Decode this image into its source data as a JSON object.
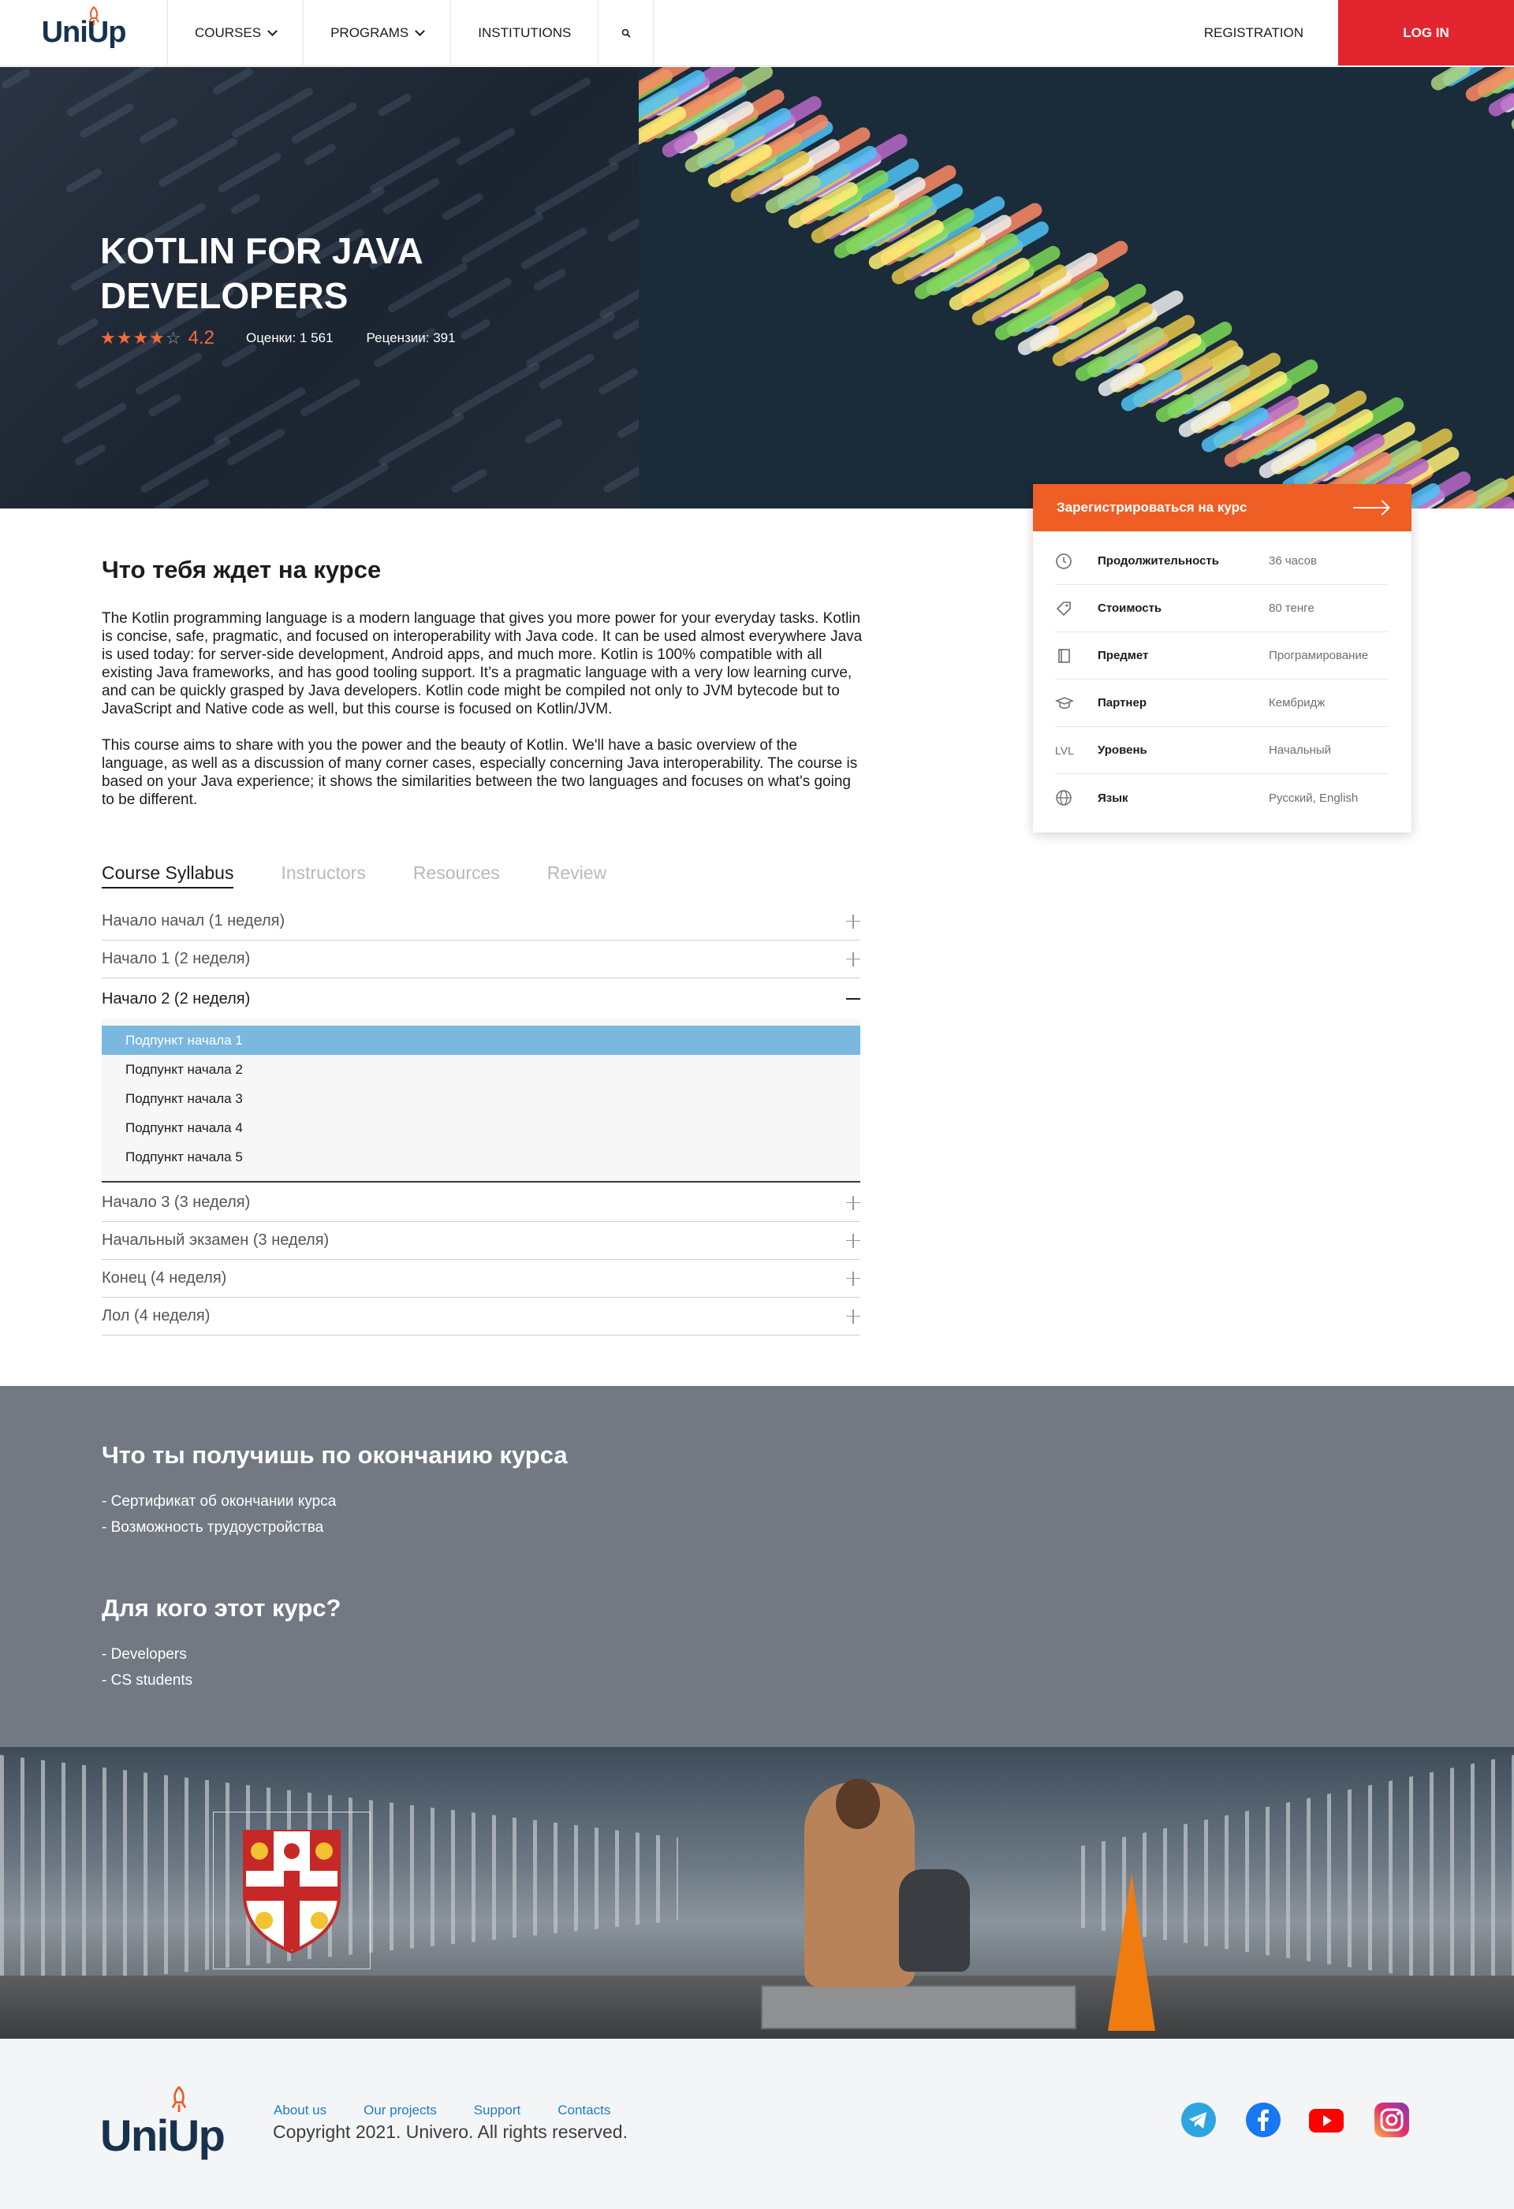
{
  "header": {
    "logo": "UniUp",
    "nav": [
      {
        "label": "COURSES",
        "dropdown": true
      },
      {
        "label": "PROGRAMS",
        "dropdown": true
      },
      {
        "label": "INSTITUTIONS",
        "dropdown": false
      }
    ],
    "registration": "REGISTRATION",
    "login": "LOG IN"
  },
  "hero": {
    "title": "KOTLIN FOR JAVA DEVELOPERS",
    "rating": "4.2",
    "stars": 4,
    "ratings_label": "Оценки: 1 561",
    "reviews_label": "Рецензии: 391"
  },
  "card": {
    "cta": "Зарегистрироваться на курс",
    "rows": [
      {
        "icon": "clock-icon",
        "label": "Продолжительность",
        "value": "36 часов"
      },
      {
        "icon": "price-tag-icon",
        "label": "Стоимость",
        "value": "80 тенге"
      },
      {
        "icon": "book-icon",
        "label": "Предмет",
        "value": "Програмирование"
      },
      {
        "icon": "graduation-cap-icon",
        "label": "Партнер",
        "value": "Кембридж"
      },
      {
        "icon": "level-icon",
        "icon_text": "LVL",
        "label": "Уровень",
        "value": "Начальный"
      },
      {
        "icon": "globe-icon",
        "label": "Язык",
        "value": "Русский, English"
      }
    ]
  },
  "about": {
    "heading": "Что тебя ждет на курсе",
    "paragraphs": [
      "The Kotlin programming language is a modern language that gives you more power for your everyday tasks. Kotlin is concise, safe, pragmatic, and focused on interoperability with Java code. It can be used almost everywhere Java is used today: for server-side development, Android apps, and much more. Kotlin is 100% compatible with all existing Java frameworks, and has good tooling support. It’s a pragmatic language with a very low learning curve, and can be quickly grasped by Java developers. Kotlin code might be compiled not only to JVM bytecode but to JavaScript and Native code as well, but this course is focused on Kotlin/JVM.",
      "This course aims to share with you the power and the beauty of Kotlin. We'll have a basic overview of the language, as well as a discussion of many corner cases, especially concerning Java interoperability. The course is based on your Java experience; it shows the similarities between the two languages and focuses on what's going to be different."
    ]
  },
  "tabs": [
    "Course Syllabus",
    "Instructors",
    "Resources",
    "Review"
  ],
  "syllabus": {
    "before": [
      "Начало начал (1 неделя)",
      "Начало 1 (2 неделя)"
    ],
    "open": "Начало 2 (2 неделя)",
    "subitems": [
      "Подпункт начала 1",
      "Подпункт начала 2",
      "Подпункт начала 3",
      "Подпункт начала 4",
      "Подпункт начала 5"
    ],
    "after": [
      "Начало 3 (3 неделя)",
      "Начальный экзамен (3 неделя)",
      "Конец (4 неделя)",
      "Лол (4 неделя)"
    ]
  },
  "outcomes": {
    "heading": "Что ты получишь по окончанию курса",
    "items": [
      "Сертификат об окончании курса",
      "Возможность трудоустройства"
    ]
  },
  "audience": {
    "heading": "Для кого этот курс?",
    "items": [
      "Developers",
      "CS students"
    ]
  },
  "footer": {
    "logo": "UniUp",
    "links": [
      "About us",
      "Our projects",
      "Support",
      "Contacts"
    ],
    "copyright": "Copyright 2021. Univero. All rights reserved.",
    "social": [
      "telegram-icon",
      "facebook-icon",
      "youtube-icon",
      "instagram-icon"
    ]
  },
  "colors": {
    "accent_red": "#e2252f",
    "accent_orange": "#ef5e24",
    "star": "#f26b3a",
    "active_subitem": "#7ab8df",
    "grey_section": "#737982",
    "link": "#1e7dc4"
  }
}
